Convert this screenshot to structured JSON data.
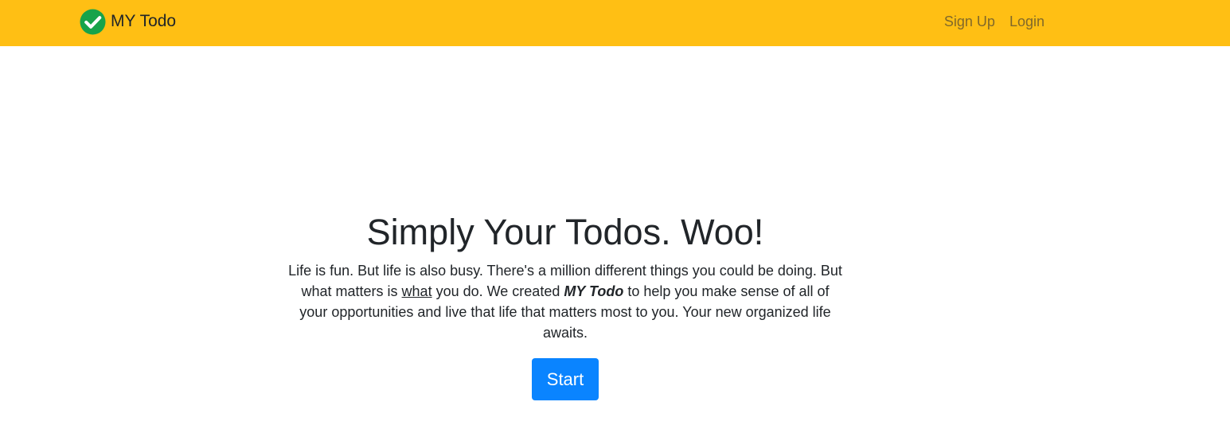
{
  "navbar": {
    "brand_icon": "check-circle-icon",
    "brand_name": "MY Todo",
    "links": [
      {
        "label": "Sign Up"
      },
      {
        "label": "Login"
      }
    ],
    "background_color": "#ffbf14"
  },
  "hero": {
    "title": "Simply Your Todos. Woo!",
    "text_part1": "Life is fun. But life is also busy. There's a million different things you could be doing. But what matters is ",
    "text_emphasis_underline": "what",
    "text_part2": " you do. We created ",
    "text_brand": "MY Todo",
    "text_part3": " to help you make sense of all of your opportunities and live that life that matters most to you. Your new organized life awaits.",
    "start_label": "Start",
    "start_color": "#0a84ff"
  }
}
